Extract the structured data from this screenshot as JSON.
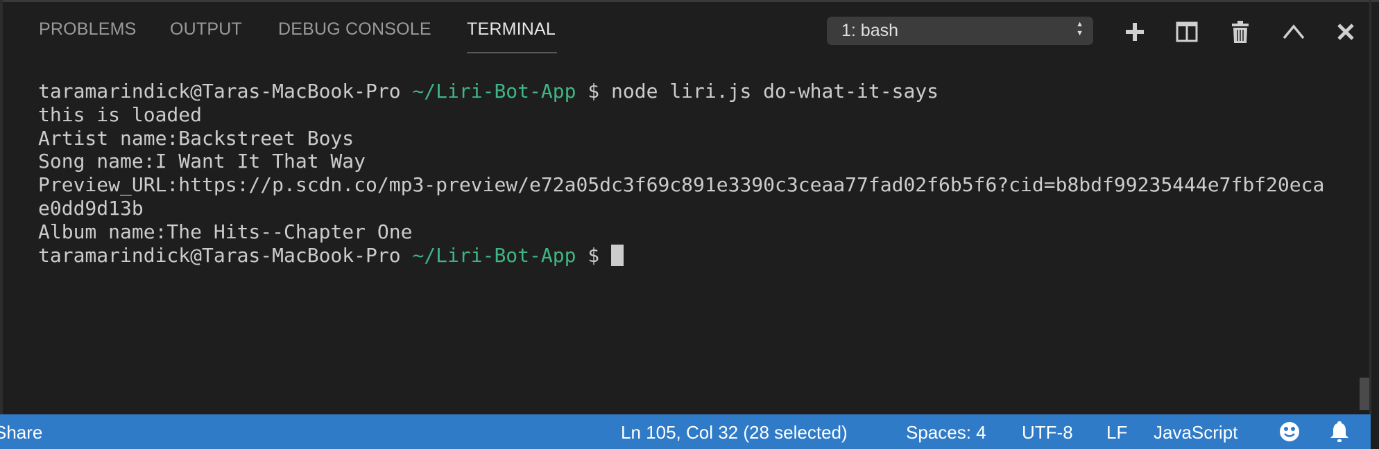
{
  "panel": {
    "tabs": [
      {
        "label": "PROBLEMS",
        "active": false
      },
      {
        "label": "OUTPUT",
        "active": false
      },
      {
        "label": "DEBUG CONSOLE",
        "active": false
      },
      {
        "label": "TERMINAL",
        "active": true
      }
    ],
    "terminal_select": "1: bash",
    "actions": [
      "plus-icon",
      "split-icon",
      "trash-icon",
      "chevron-up-icon",
      "close-icon"
    ]
  },
  "terminal": {
    "prompt_user": "taramarindick@Taras-MacBook-Pro ",
    "prompt_path": "~/Liri-Bot-App",
    "command": " $ node liri.js do-what-it-says",
    "output": [
      "this is loaded",
      "Artist name:Backstreet Boys",
      "Song name:I Want It That Way",
      "Preview_URL:https://p.scdn.co/mp3-preview/e72a05dc3f69c891e3390c3ceaa77fad02f6b5f6?cid=b8bdf99235444e7fbf20eca",
      "e0dd9d13b",
      "Album name:The Hits--Chapter One"
    ],
    "final_prompt_user": "taramarindick@Taras-MacBook-Pro ",
    "final_prompt_path": "~/Liri-Bot-App",
    "final_prompt_symbol": " $ "
  },
  "statusbar": {
    "share": "Share",
    "position": "Ln 105, Col 32 (28 selected)",
    "indent": "Spaces: 4",
    "encoding": "UTF-8",
    "eol": "LF",
    "language": "JavaScript",
    "color": "#2f7bc7"
  }
}
